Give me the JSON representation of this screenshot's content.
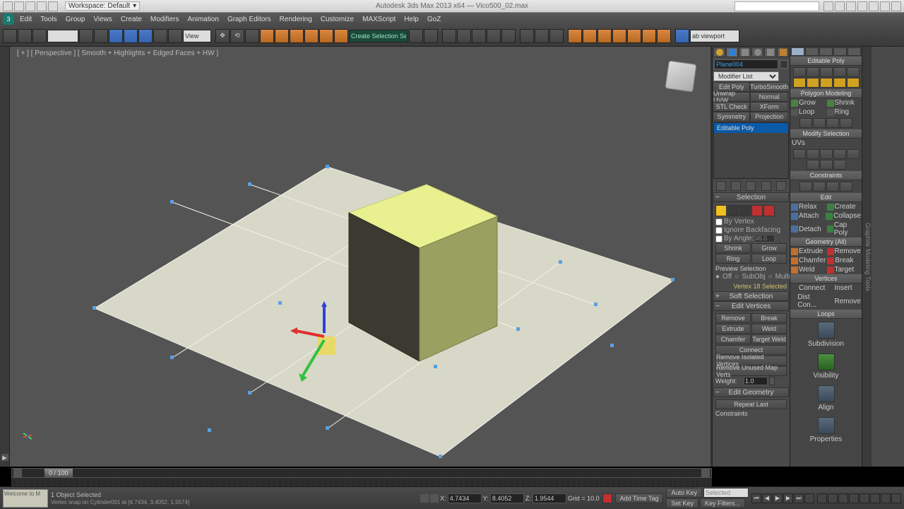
{
  "app_title": "Autodesk 3ds Max 2013 x64 — Vico500_02.max",
  "workspace": "Workspace: Default",
  "menus": [
    "Edit",
    "Tools",
    "Group",
    "Views",
    "Create",
    "Modifiers",
    "Animation",
    "Graph Editors",
    "Rendering",
    "Customize",
    "MAXScript",
    "Help",
    "GoZ"
  ],
  "toolbar": {
    "layer_combo": "",
    "selset_combo": "Create Selection Set",
    "viewport_combo": "ab viewport"
  },
  "viewport": {
    "label": "[ + ] [ Perspective ] [ Smooth + Highlights + Edged Faces + HW ]"
  },
  "object_name": "Plane004",
  "modlist_placeholder": "Modifier List",
  "mod_buttons": [
    "Edit Poly",
    "TurboSmooth",
    "Unwrap UVW",
    "Normal",
    "STL Check",
    "XForm",
    "Symmetry",
    "Projection"
  ],
  "stack_item": "Editable Poly",
  "selection": {
    "header": "Selection",
    "by_vertex": "By Vertex",
    "ignore_backfacing": "Ignore Backfacing",
    "by_angle": "By Angle:",
    "angle_val": "45.0",
    "shrink": "Shrink",
    "grow": "Grow",
    "ring": "Ring",
    "loop": "Loop",
    "preview_sel": "Preview Selection",
    "off": "Off",
    "subobj": "SubObj",
    "multi": "Multi",
    "verts_selected": "Vertex 18 Selected"
  },
  "soft_sel": "Soft Selection",
  "edit_verts": {
    "header": "Edit Vertices",
    "remove": "Remove",
    "break": "Break",
    "extrude": "Extrude",
    "weld": "Weld",
    "chamfer": "Chamfer",
    "target_weld": "Target Weld",
    "connect": "Connect",
    "rem_iso": "Remove Isolated Vertices",
    "rem_unused": "Remove Unused Map Verts",
    "weight": "Weight:",
    "weight_val": "1.0"
  },
  "edit_geom": {
    "header": "Edit Geometry",
    "repeat": "Repeat Last",
    "constraints": "Constraints"
  },
  "ribbon": {
    "hdr1": "Editable Poly",
    "hdr_poly": "Polygon Modeling",
    "grow": "Grow",
    "shrink": "Shrink",
    "loop": "Loop",
    "ring": "Ring",
    "modify_sel": "Modify Selection",
    "uvs": "UVs",
    "constraints": "Constraints",
    "edit": "Edit",
    "relax": "Relax",
    "create": "Create",
    "attach": "Attach",
    "collapse": "Collapse",
    "detach": "Detach",
    "cap_poly": "Cap Poly",
    "geom_all": "Geometry (All)",
    "extrude": "Extrude",
    "remove": "Remove",
    "chamfer": "Chamfer",
    "break": "Break",
    "weld": "Weld",
    "target": "Target",
    "vertices": "Vertices",
    "connect": "Connect",
    "insert": "Insert",
    "dist_con": "Dist Con...",
    "remove2": "Remove",
    "loops": "Loops",
    "subdivision": "Subdivision",
    "visibility": "Visibility",
    "align": "Align",
    "properties": "Properties"
  },
  "timeline": {
    "pos": "0 / 100"
  },
  "status": {
    "welcome": "Welcome to M",
    "msg1": "1 Object Selected",
    "msg2": "Vertex snap on Cylinder001 at [4.7434, 3.4052, 1.5574]",
    "x": "4.7434",
    "y": "8.4052",
    "z": "1.9544",
    "grid": "Grid = 10.0",
    "autokey": "Auto Key",
    "selected": "Selected",
    "setkey": "Set Key",
    "keyfilters": "Key Filters...",
    "addtimetag": "Add Time Tag"
  }
}
